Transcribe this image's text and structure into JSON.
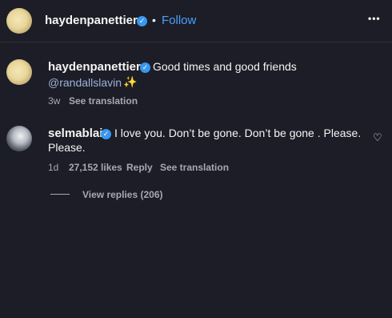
{
  "header": {
    "username": "haydenpanettiere",
    "separator": "•",
    "follow_label": "Follow",
    "more_label": "•••"
  },
  "caption": {
    "username": "haydenpanettiere",
    "text": "Good times and good friends",
    "mention": "@randallslavin",
    "sparkle": "✨",
    "time": "3w",
    "see_translation": "See translation"
  },
  "comment": {
    "username": "selmablair",
    "text_line1": "I love you. Don’t be gone. Don’t be gone . Please.",
    "text_line2": "Please.",
    "time": "1d",
    "likes": "27,152 likes",
    "reply": "Reply",
    "see_translation": "See translation",
    "view_replies": "View replies (206)"
  },
  "icons": {
    "verified": "verified-badge-icon",
    "heart": "heart-outline-icon",
    "more": "more-options-icon"
  },
  "colors": {
    "background": "#1c1d26",
    "accent_blue": "#4c9ffe",
    "verified_blue": "#3897f0",
    "muted_text": "#a8a8b2"
  }
}
